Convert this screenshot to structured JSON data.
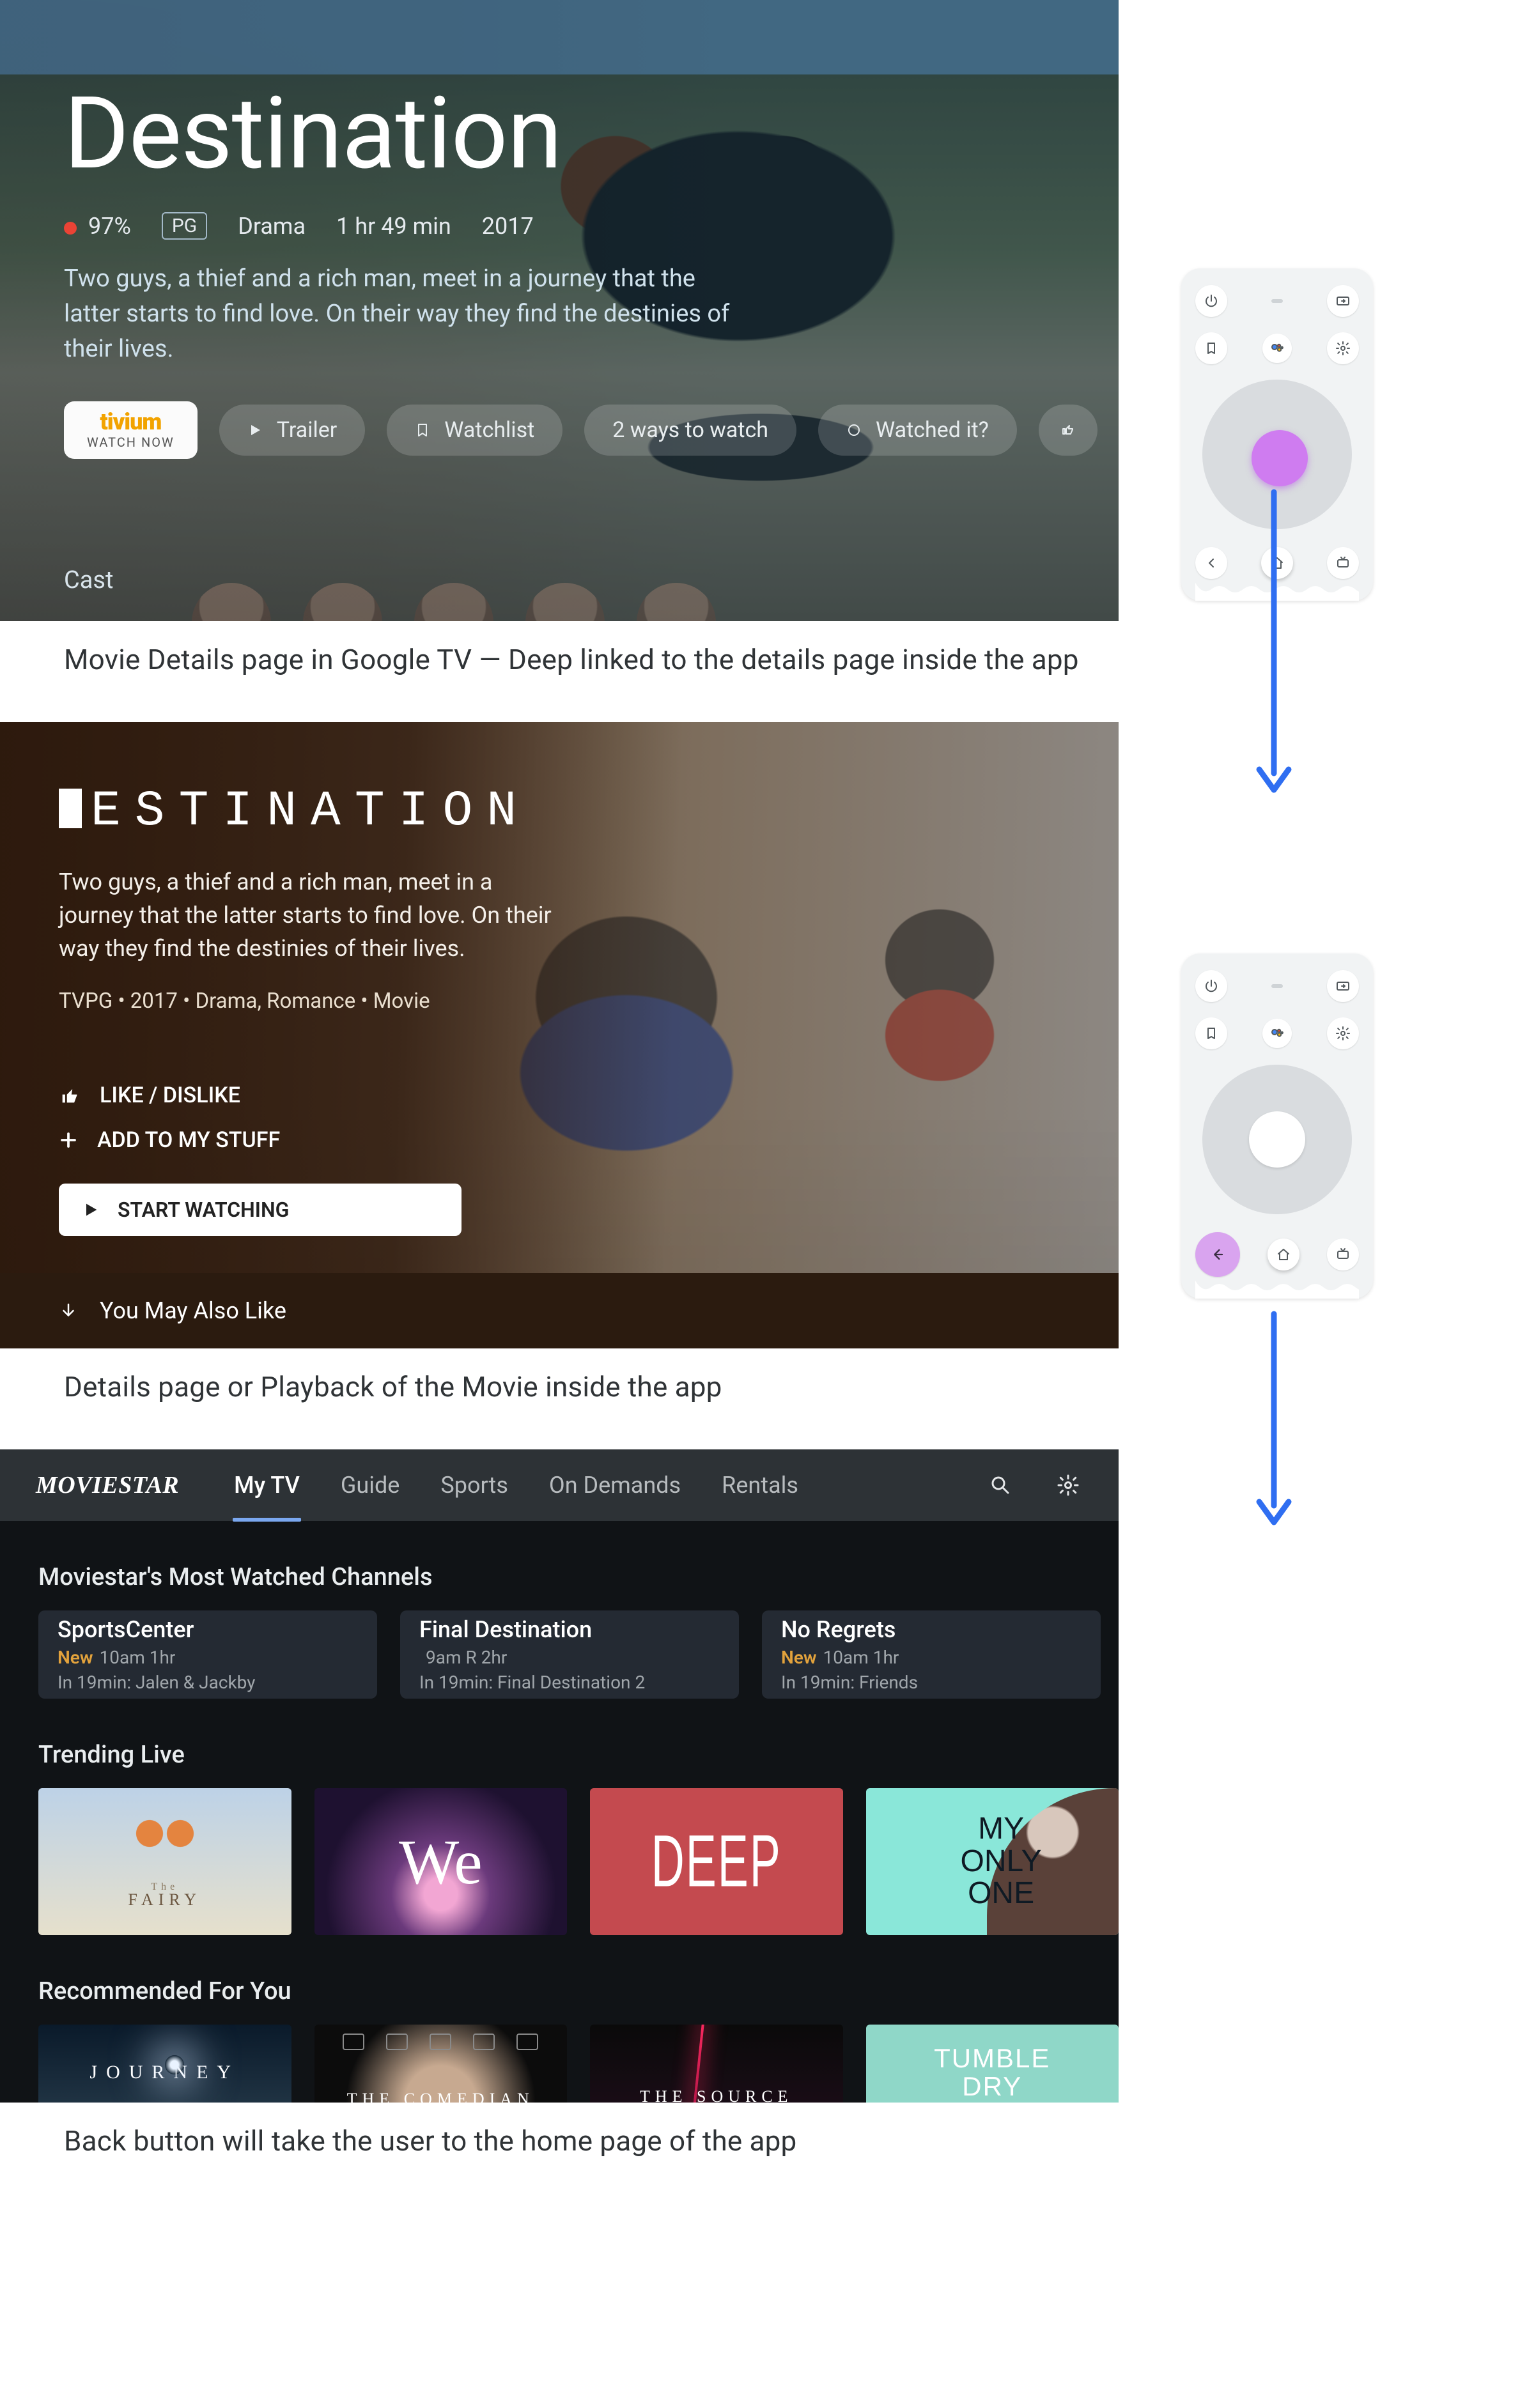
{
  "captions": {
    "c1": "Movie Details page in Google TV — Deep linked to the details page inside the app",
    "c2": "Details page or Playback of the Movie inside the app",
    "c3": "Back button will take the user to the home page of the app"
  },
  "gtv": {
    "title": "Destination",
    "score": "97%",
    "rating": "PG",
    "genre": "Drama",
    "runtime": "1 hr 49 min",
    "year": "2017",
    "description": "Two guys, a thief and a rich man, meet in a journey that the latter starts to find love. On their way they find the destinies of their lives.",
    "cast_label": "Cast",
    "primary_cta": {
      "brand": "tivium",
      "sub": "WATCH NOW"
    },
    "buttons": {
      "trailer": "Trailer",
      "watchlist": "Watchlist",
      "ways": "2 ways to watch",
      "watched": "Watched it?"
    }
  },
  "app": {
    "title": "ESTINATION",
    "description": "Two guys, a thief and a rich man, meet in a journey that the latter starts to find love. On their way they find the destinies of their lives.",
    "meta": "TVPG • 2017 • Drama, Romance • Movie",
    "like": "LIKE / DISLIKE",
    "add": "ADD TO MY STUFF",
    "start": "START WATCHING",
    "ymal": "You May Also Like"
  },
  "home": {
    "brand": "MOVIESTAR",
    "tabs": [
      "My TV",
      "Guide",
      "Sports",
      "On Demands",
      "Rentals"
    ],
    "section1": "Moviestar's Most Watched Channels",
    "cards": [
      {
        "title": "SportsCenter",
        "new": "New",
        "line1a": "10am 1hr",
        "line2": "In 19min: Jalen & Jackby"
      },
      {
        "title": "Final Destination",
        "new": "",
        "line1a": "9am R 2hr",
        "line2": "In 19min: Final Destination 2"
      },
      {
        "title": "No Regrets",
        "new": "New",
        "line1a": "10am 1hr",
        "line2": "In 19min: Friends"
      }
    ],
    "section2": "Trending Live",
    "trending": [
      {
        "pre": "The",
        "label": "FAIRY"
      },
      {
        "label": "We"
      },
      {
        "label": "DEEP"
      },
      {
        "label": "MY\nONLY\nONE"
      }
    ],
    "section3": "Recommended For You",
    "recommended": [
      {
        "label": "JOURNEY"
      },
      {
        "label": "THE COMEDIAN"
      },
      {
        "label": "THE SOURCE"
      },
      {
        "label": "TUMBLE\nDRY"
      }
    ]
  }
}
